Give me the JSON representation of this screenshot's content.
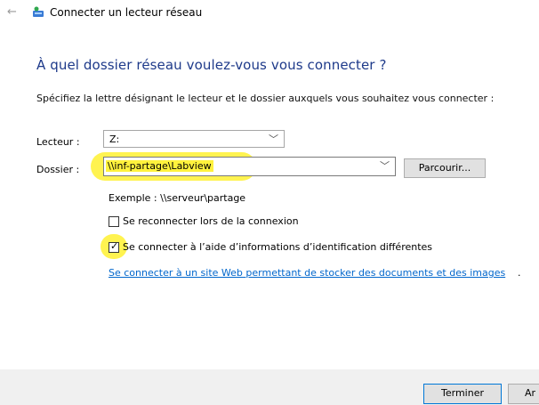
{
  "window": {
    "back_glyph": "←",
    "title": "Connecter un lecteur réseau",
    "icon": "network-drive-icon"
  },
  "heading": "À quel dossier réseau voulez-vous vous connecter ?",
  "instructions": "Spécifiez la lettre désignant le lecteur et le dossier auxquels vous souhaitez vous connecter :",
  "drive": {
    "label": "Lecteur :",
    "value": "Z:",
    "chevron": "﹀"
  },
  "folder": {
    "label": "Dossier :",
    "value": "\\\\inf-partage\\Labview",
    "chevron": "﹀",
    "browse_label": "Parcourir..."
  },
  "example": "Exemple : \\\\serveur\\partage",
  "options": [
    {
      "label": "Se reconnecter lors de la connexion",
      "checked": false
    },
    {
      "label": "Se connecter à l’aide d’informations d’identification différentes",
      "checked": true
    }
  ],
  "check_mark": "✓",
  "link": "Se connecter à un site Web permettant de stocker des documents et des images",
  "link_suffix": ".",
  "footer": {
    "finish_label": "Terminer",
    "cancel_label": "Ar"
  },
  "colors": {
    "heading": "#1e3a8a",
    "link": "#0066cc",
    "highlight": "#fff23d",
    "footer": "#f0f0f0"
  }
}
